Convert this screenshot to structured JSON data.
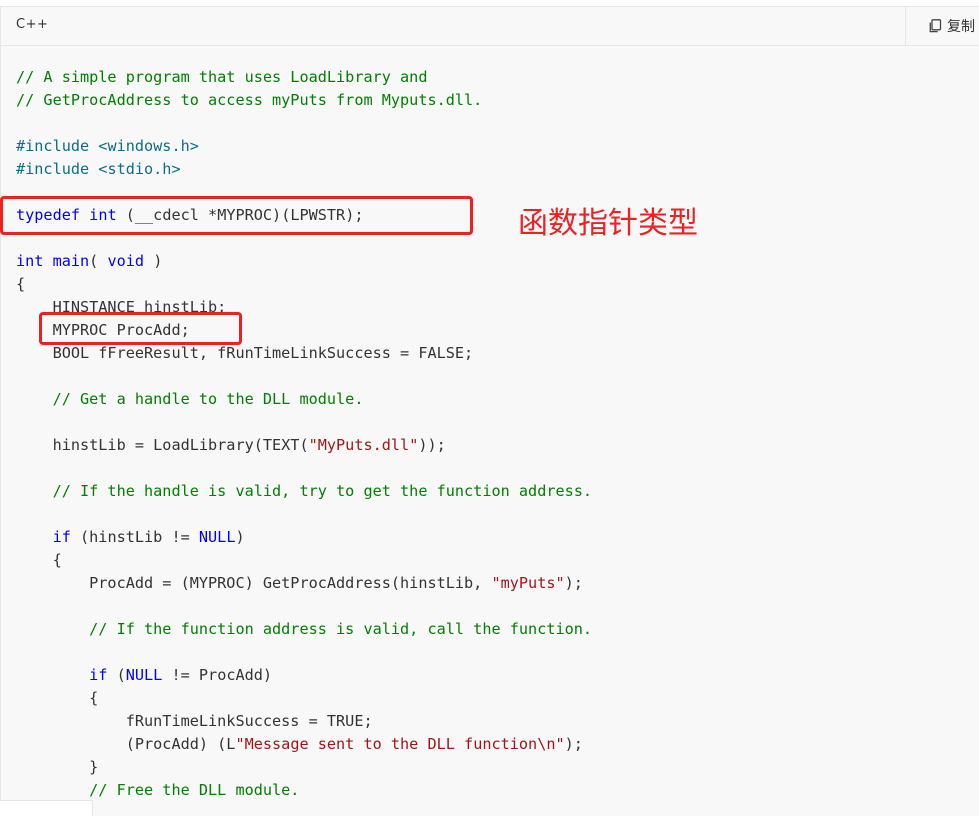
{
  "code_block": {
    "language": "C++",
    "copy_label": "复制",
    "copy_icon": "copy-icon",
    "lines": [
      [
        {
          "t": "// A simple program that uses LoadLibrary and",
          "c": "comment"
        }
      ],
      [
        {
          "t": "// GetProcAddress to access myPuts from Myputs.dll.",
          "c": "comment"
        }
      ],
      [],
      [
        {
          "t": "#include ",
          "c": "preprocessor"
        },
        {
          "t": "<windows.h>",
          "c": "include"
        }
      ],
      [
        {
          "t": "#include ",
          "c": "preprocessor"
        },
        {
          "t": "<stdio.h>",
          "c": "include"
        }
      ],
      [],
      [
        {
          "t": "typedef",
          "c": "keyword"
        },
        {
          "t": " ",
          "c": "plain"
        },
        {
          "t": "int",
          "c": "keyword"
        },
        {
          "t": " (__cdecl *MYPROC)(LPWSTR);",
          "c": "plain"
        }
      ],
      [],
      [
        {
          "t": "int",
          "c": "keyword"
        },
        {
          "t": " ",
          "c": "plain"
        },
        {
          "t": "main",
          "c": "keyword"
        },
        {
          "t": "( ",
          "c": "plain"
        },
        {
          "t": "void",
          "c": "keyword"
        },
        {
          "t": " )",
          "c": "plain"
        }
      ],
      [
        {
          "t": "{",
          "c": "plain"
        }
      ],
      [
        {
          "t": "    HINSTANCE hinstLib;",
          "c": "plain"
        }
      ],
      [
        {
          "t": "    MYPROC ProcAdd;",
          "c": "plain"
        }
      ],
      [
        {
          "t": "    BOOL fFreeResult, fRunTimeLinkSuccess = FALSE;",
          "c": "plain"
        }
      ],
      [],
      [
        {
          "t": "    // Get a handle to the DLL module.",
          "c": "comment"
        }
      ],
      [],
      [
        {
          "t": "    hinstLib = LoadLibrary(TEXT(",
          "c": "plain"
        },
        {
          "t": "\"MyPuts.dll\"",
          "c": "string"
        },
        {
          "t": "));",
          "c": "plain"
        }
      ],
      [],
      [
        {
          "t": "    // If the handle is valid, try to get the function address.",
          "c": "comment"
        }
      ],
      [],
      [
        {
          "t": "    ",
          "c": "plain"
        },
        {
          "t": "if",
          "c": "keyword"
        },
        {
          "t": " (hinstLib != ",
          "c": "plain"
        },
        {
          "t": "NULL",
          "c": "macro"
        },
        {
          "t": ")",
          "c": "plain"
        }
      ],
      [
        {
          "t": "    {",
          "c": "plain"
        }
      ],
      [
        {
          "t": "        ProcAdd = (MYPROC) GetProcAddress(hinstLib, ",
          "c": "plain"
        },
        {
          "t": "\"myPuts\"",
          "c": "string"
        },
        {
          "t": ");",
          "c": "plain"
        }
      ],
      [],
      [
        {
          "t": "        // If the function address is valid, call the function.",
          "c": "comment"
        }
      ],
      [],
      [
        {
          "t": "        ",
          "c": "plain"
        },
        {
          "t": "if",
          "c": "keyword"
        },
        {
          "t": " (",
          "c": "plain"
        },
        {
          "t": "NULL",
          "c": "macro"
        },
        {
          "t": " != ProcAdd)",
          "c": "plain"
        }
      ],
      [
        {
          "t": "        {",
          "c": "plain"
        }
      ],
      [
        {
          "t": "            fRunTimeLinkSuccess = TRUE;",
          "c": "plain"
        }
      ],
      [
        {
          "t": "            (ProcAdd) (L",
          "c": "plain"
        },
        {
          "t": "\"Message sent to the DLL function\\n\"",
          "c": "string"
        },
        {
          "t": ");",
          "c": "plain"
        }
      ],
      [
        {
          "t": "        }",
          "c": "plain"
        }
      ],
      [
        {
          "t": "        // Free the DLL module.",
          "c": "comment"
        }
      ]
    ]
  },
  "annotations": {
    "typedef_note": "函数指针类型"
  },
  "colors": {
    "comment": "#008000",
    "keyword": "#0000ff",
    "string": "#a31515",
    "preprocessor": "#0b6e8a",
    "highlight": "#ee2020"
  }
}
